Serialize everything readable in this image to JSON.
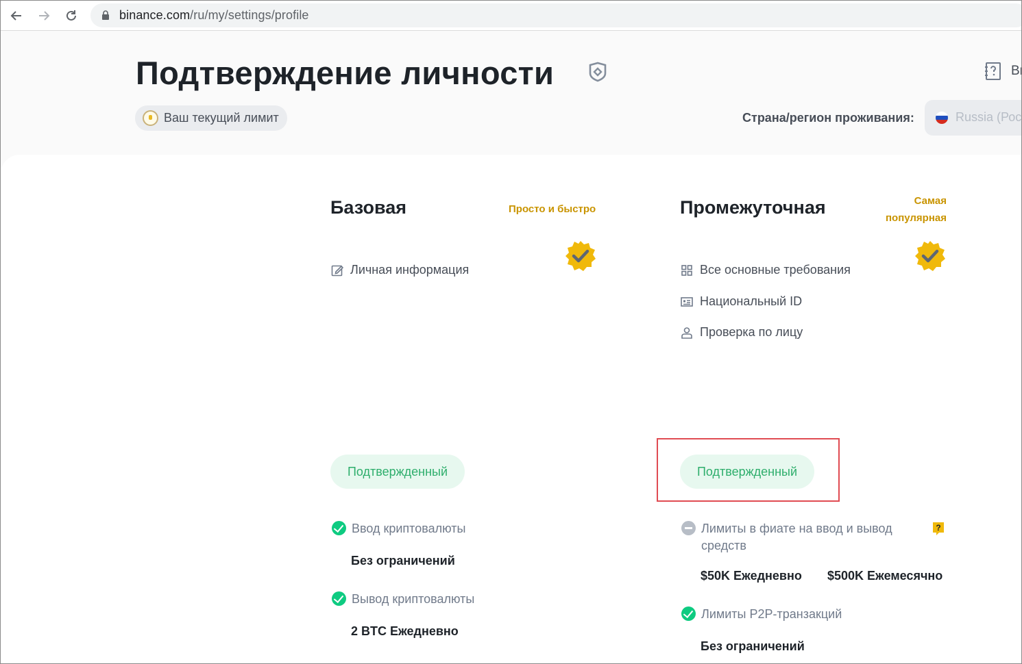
{
  "browser": {
    "url_host": "binance.com",
    "url_path": "/ru/my/settings/profile"
  },
  "header": {
    "title": "Подтверждение личности",
    "help_text": "Ви",
    "limit_label": "Ваш текущий лимит",
    "country_label": "Страна/регион проживания:",
    "country_value": "Russia (Росс"
  },
  "levels": [
    {
      "title": "Базовая",
      "tag": "Просто и быстро",
      "requirements": [
        "Личная информация"
      ],
      "status": "Подтвержденный",
      "features": [
        {
          "label": "Ввод криптовалюты",
          "value": "Без ограничений"
        },
        {
          "label": "Вывод криптовалюты",
          "value": "2 BTC Ежедневно"
        }
      ]
    },
    {
      "title": "Промежуточная",
      "tag_line1": "Самая",
      "tag_line2": "популярная",
      "requirements": [
        "Все основные требования",
        "Национальный ID",
        "Проверка по лицу"
      ],
      "status": "Подтвержденный",
      "features": [
        {
          "label_line1": "Лимиты в фиате на ввод и вывод",
          "label_line2": "средств",
          "value_daily": "$50K Ежедневно",
          "value_monthly": "$500K Ежемесячно"
        },
        {
          "label": "Лимиты P2P-транзакций",
          "value": "Без ограничений"
        }
      ]
    }
  ],
  "colors": {
    "accent_gold": "#c99400",
    "verified_green": "#0ecb81",
    "verified_bg": "#e7f8ef",
    "highlight_red": "#e04b52"
  },
  "icons": {
    "back": "arrow-left-icon",
    "forward": "arrow-right-icon",
    "reload": "reload-icon",
    "lock": "lock-icon",
    "shield": "shield-icon",
    "help": "help-book-icon",
    "badge": "verified-badge-icon",
    "edit": "edit-icon",
    "grid": "grid-icon",
    "id_card": "id-card-icon",
    "person": "person-icon",
    "check": "check-circle-icon",
    "minus": "minus-circle-icon",
    "question": "question-icon"
  }
}
